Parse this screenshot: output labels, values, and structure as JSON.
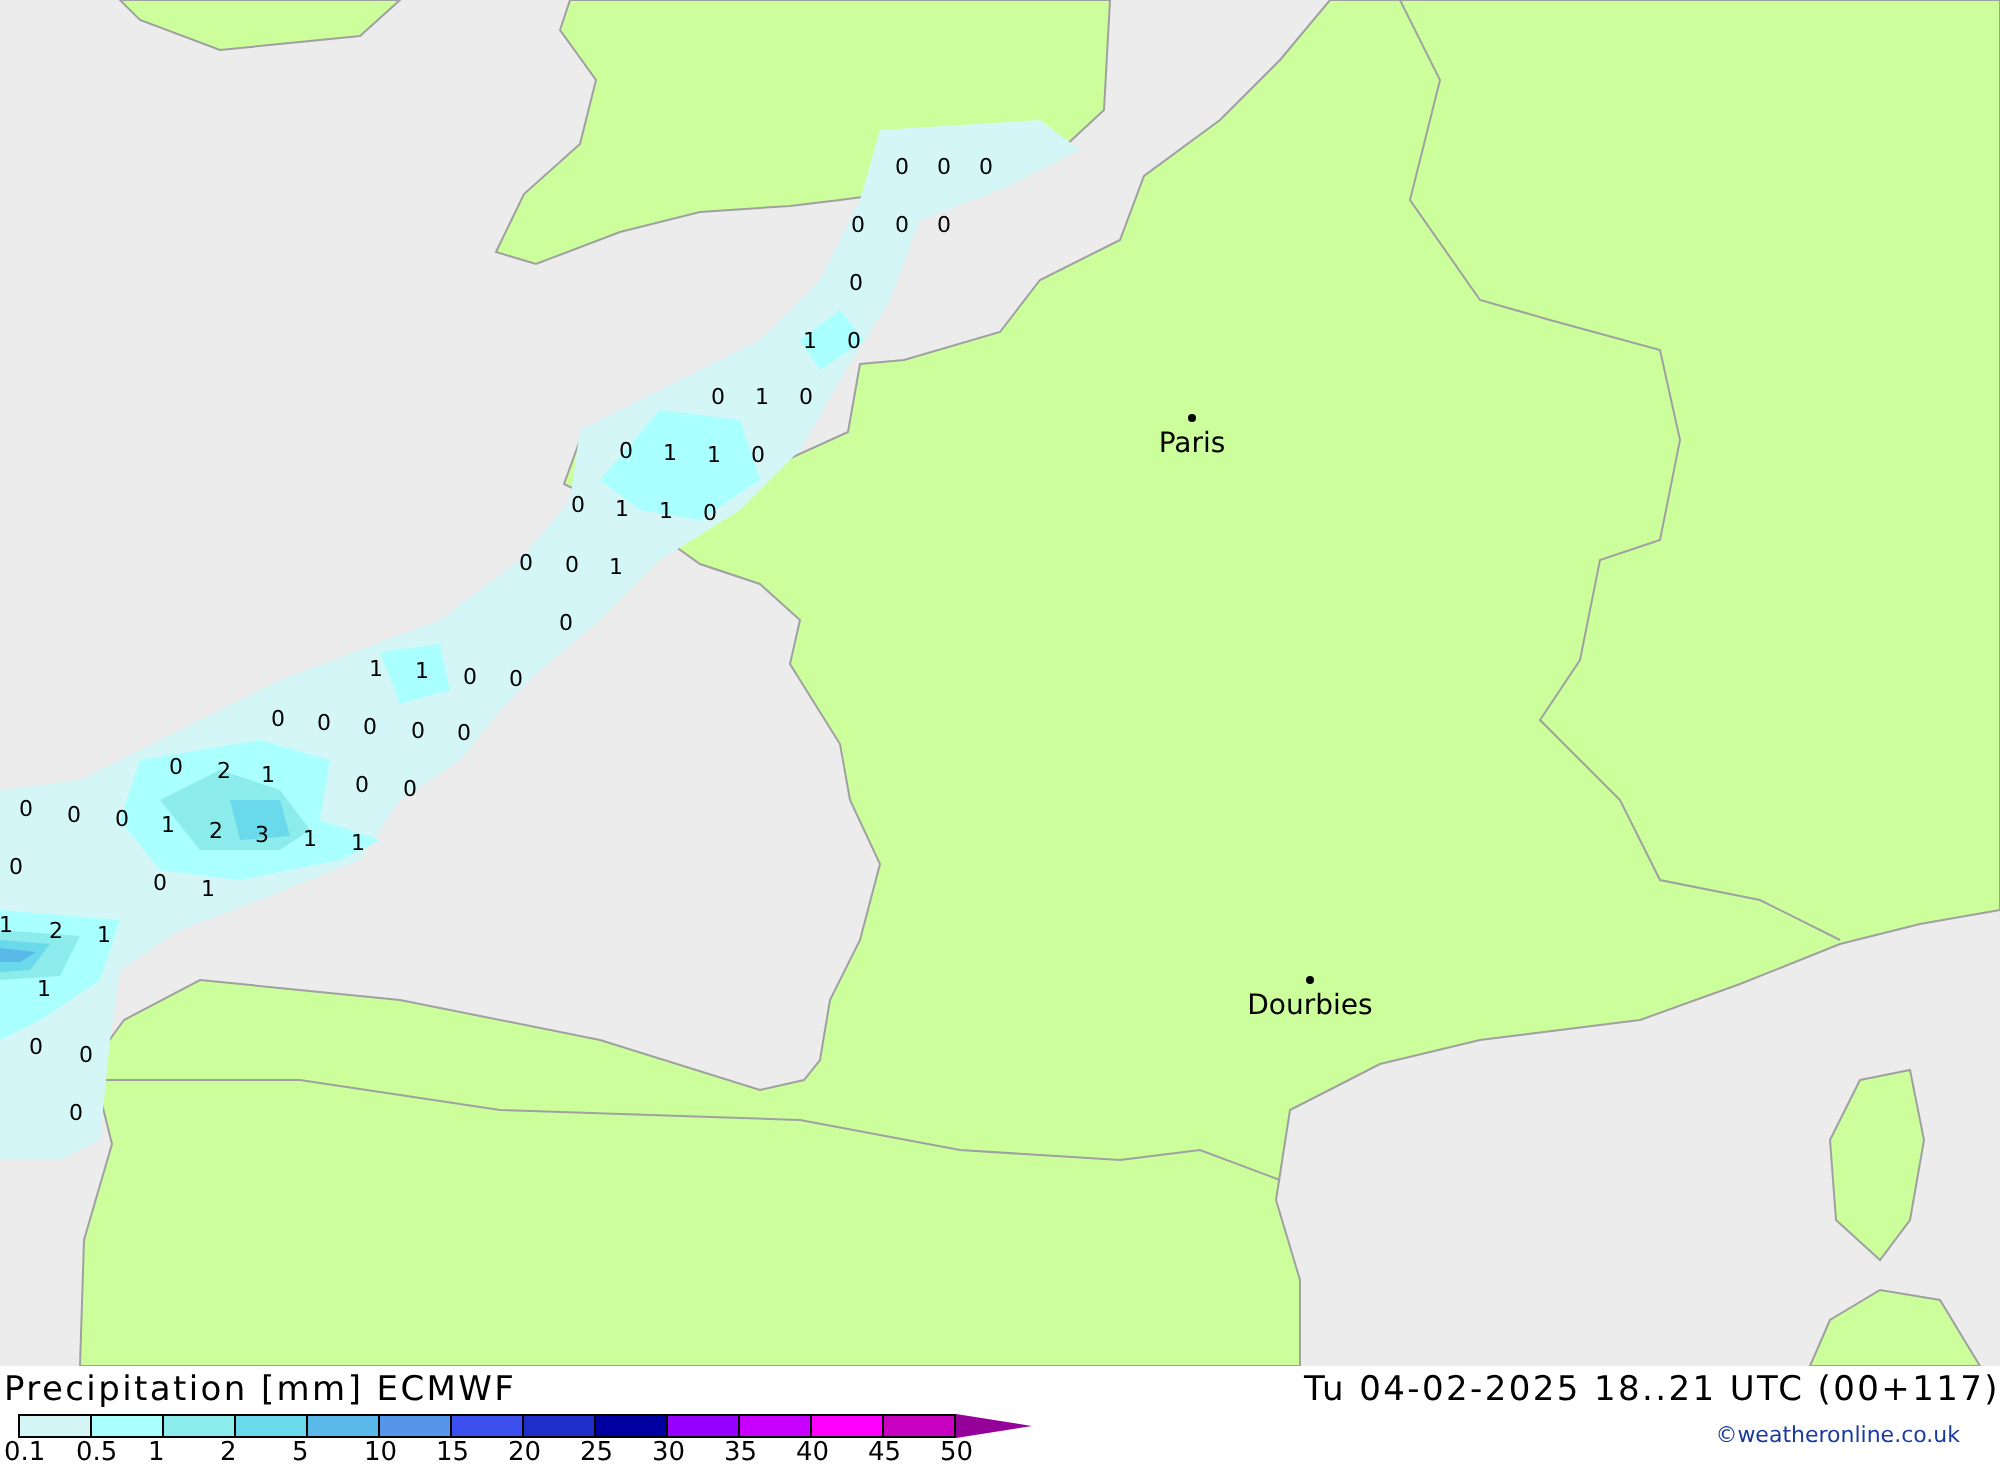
{
  "map": {
    "cities": [
      {
        "name": "Paris"
      },
      {
        "name": "Dourbies"
      }
    ],
    "values": [
      "0",
      "0",
      "0",
      "0",
      "0",
      "0",
      "0",
      "1",
      "0",
      "0",
      "1",
      "0",
      "0",
      "1",
      "1",
      "0",
      "0",
      "1",
      "1",
      "0",
      "0",
      "0",
      "1",
      "0",
      "1",
      "1",
      "0",
      "0",
      "0",
      "0",
      "0",
      "0",
      "0",
      "0",
      "2",
      "1",
      "0",
      "0",
      "0",
      "0",
      "0",
      "1",
      "2",
      "3",
      "1",
      "1",
      "0",
      "0",
      "1",
      "1",
      "2",
      "1",
      "1",
      "0",
      "0",
      "0"
    ]
  },
  "legend": {
    "title": "Precipitation [mm] ECMWF",
    "valid_time": "Tu 04-02-2025 18..21 UTC (00+117)",
    "bins": [
      {
        "kind": "cell",
        "color": "#d4f6f6"
      },
      {
        "kind": "cell",
        "color": "#aaffff"
      },
      {
        "kind": "cell",
        "color": "#8cebeb"
      },
      {
        "kind": "cell",
        "color": "#6ad9eb"
      },
      {
        "kind": "cell",
        "color": "#5ab9e9"
      },
      {
        "kind": "cell",
        "color": "#5596ea"
      },
      {
        "kind": "cell",
        "color": "#3c50f0"
      },
      {
        "kind": "cell",
        "color": "#1e2ec8"
      },
      {
        "kind": "cell",
        "color": "#0000a0"
      },
      {
        "kind": "cell",
        "color": "#9600ff"
      },
      {
        "kind": "cell",
        "color": "#c800ff"
      },
      {
        "kind": "cell",
        "color": "#ff00ff"
      },
      {
        "kind": "cell",
        "color": "#c800c0"
      },
      {
        "kind": "arrow",
        "color": "#96009a"
      }
    ],
    "ticks": [
      "0.1",
      "0.5",
      "1",
      "2",
      "5",
      "10",
      "15",
      "20",
      "25",
      "30",
      "35",
      "40",
      "45",
      "50"
    ]
  },
  "credit": "©weatheronline.co.uk"
}
